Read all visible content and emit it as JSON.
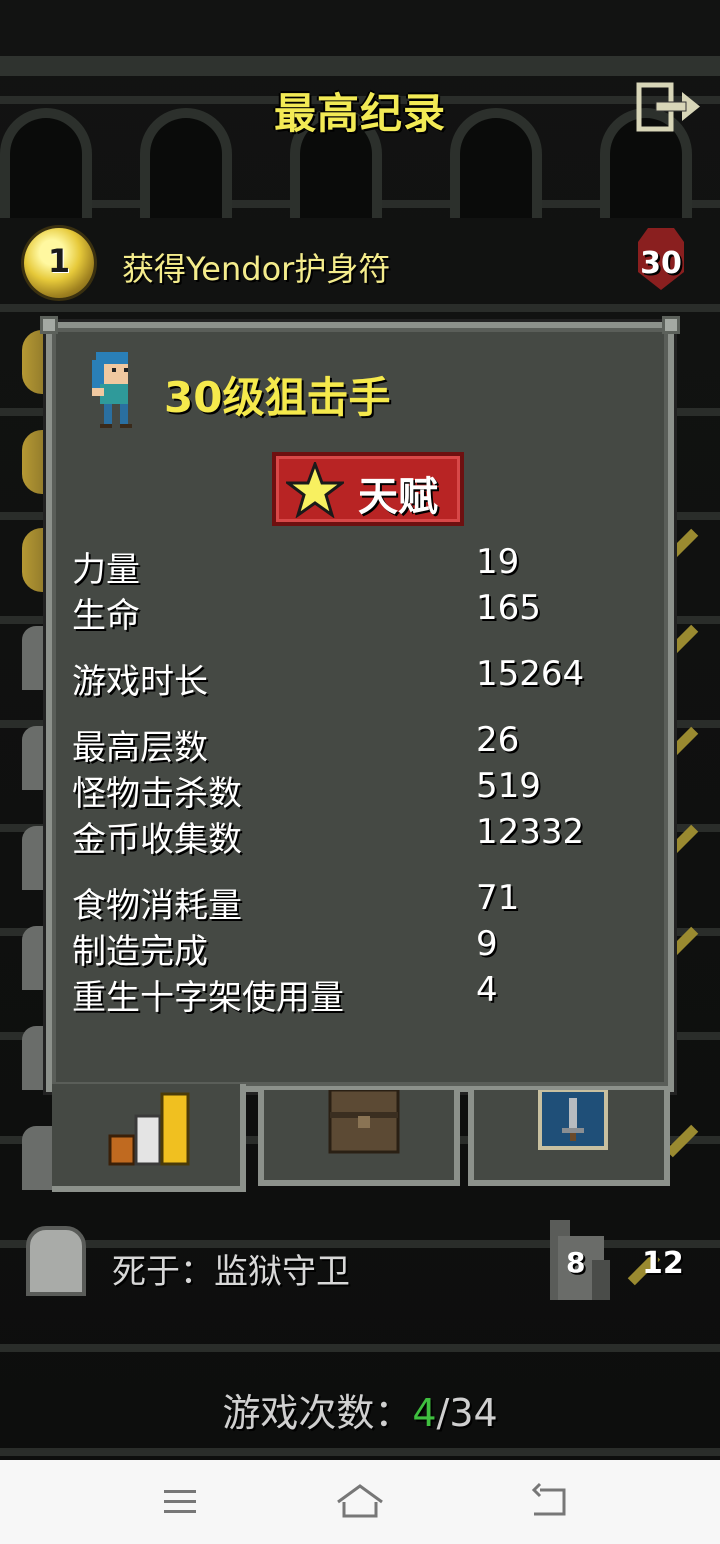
{
  "header": {
    "title": "最高纪录",
    "exit_icon": "exit-icon"
  },
  "top_record": {
    "rank": "1",
    "description": "获得Yendor护身符",
    "level": "30"
  },
  "hero": {
    "title": "30级狙击手",
    "talent_label": "天赋"
  },
  "stats": [
    {
      "label": "力量",
      "value": "19"
    },
    {
      "label": "生命",
      "value": "165"
    },
    {
      "label": "游戏时长",
      "value": "15264"
    },
    {
      "label": "最高层数",
      "value": "26"
    },
    {
      "label": "怪物击杀数",
      "value": "519"
    },
    {
      "label": "金币收集数",
      "value": "12332"
    },
    {
      "label": "食物消耗量",
      "value": "71"
    },
    {
      "label": "制造完成",
      "value": "9"
    },
    {
      "label": "重生十字架使用量",
      "value": "4"
    }
  ],
  "tabs": [
    {
      "name": "stats",
      "icon": "bar-chart-icon",
      "active": true
    },
    {
      "name": "items",
      "icon": "backpack-icon",
      "active": false
    },
    {
      "name": "badges",
      "icon": "sword-badge-icon",
      "active": false
    }
  ],
  "bottom_record": {
    "death_text": "死于：监狱守卫",
    "depth": "8",
    "level": "12"
  },
  "games_played": {
    "label": "游戏次数：",
    "current": "4",
    "separator": "/",
    "total": "34"
  },
  "colors": {
    "title": "#f2ea55",
    "talent": "#b82424",
    "current_game": "#3fbf3f"
  }
}
